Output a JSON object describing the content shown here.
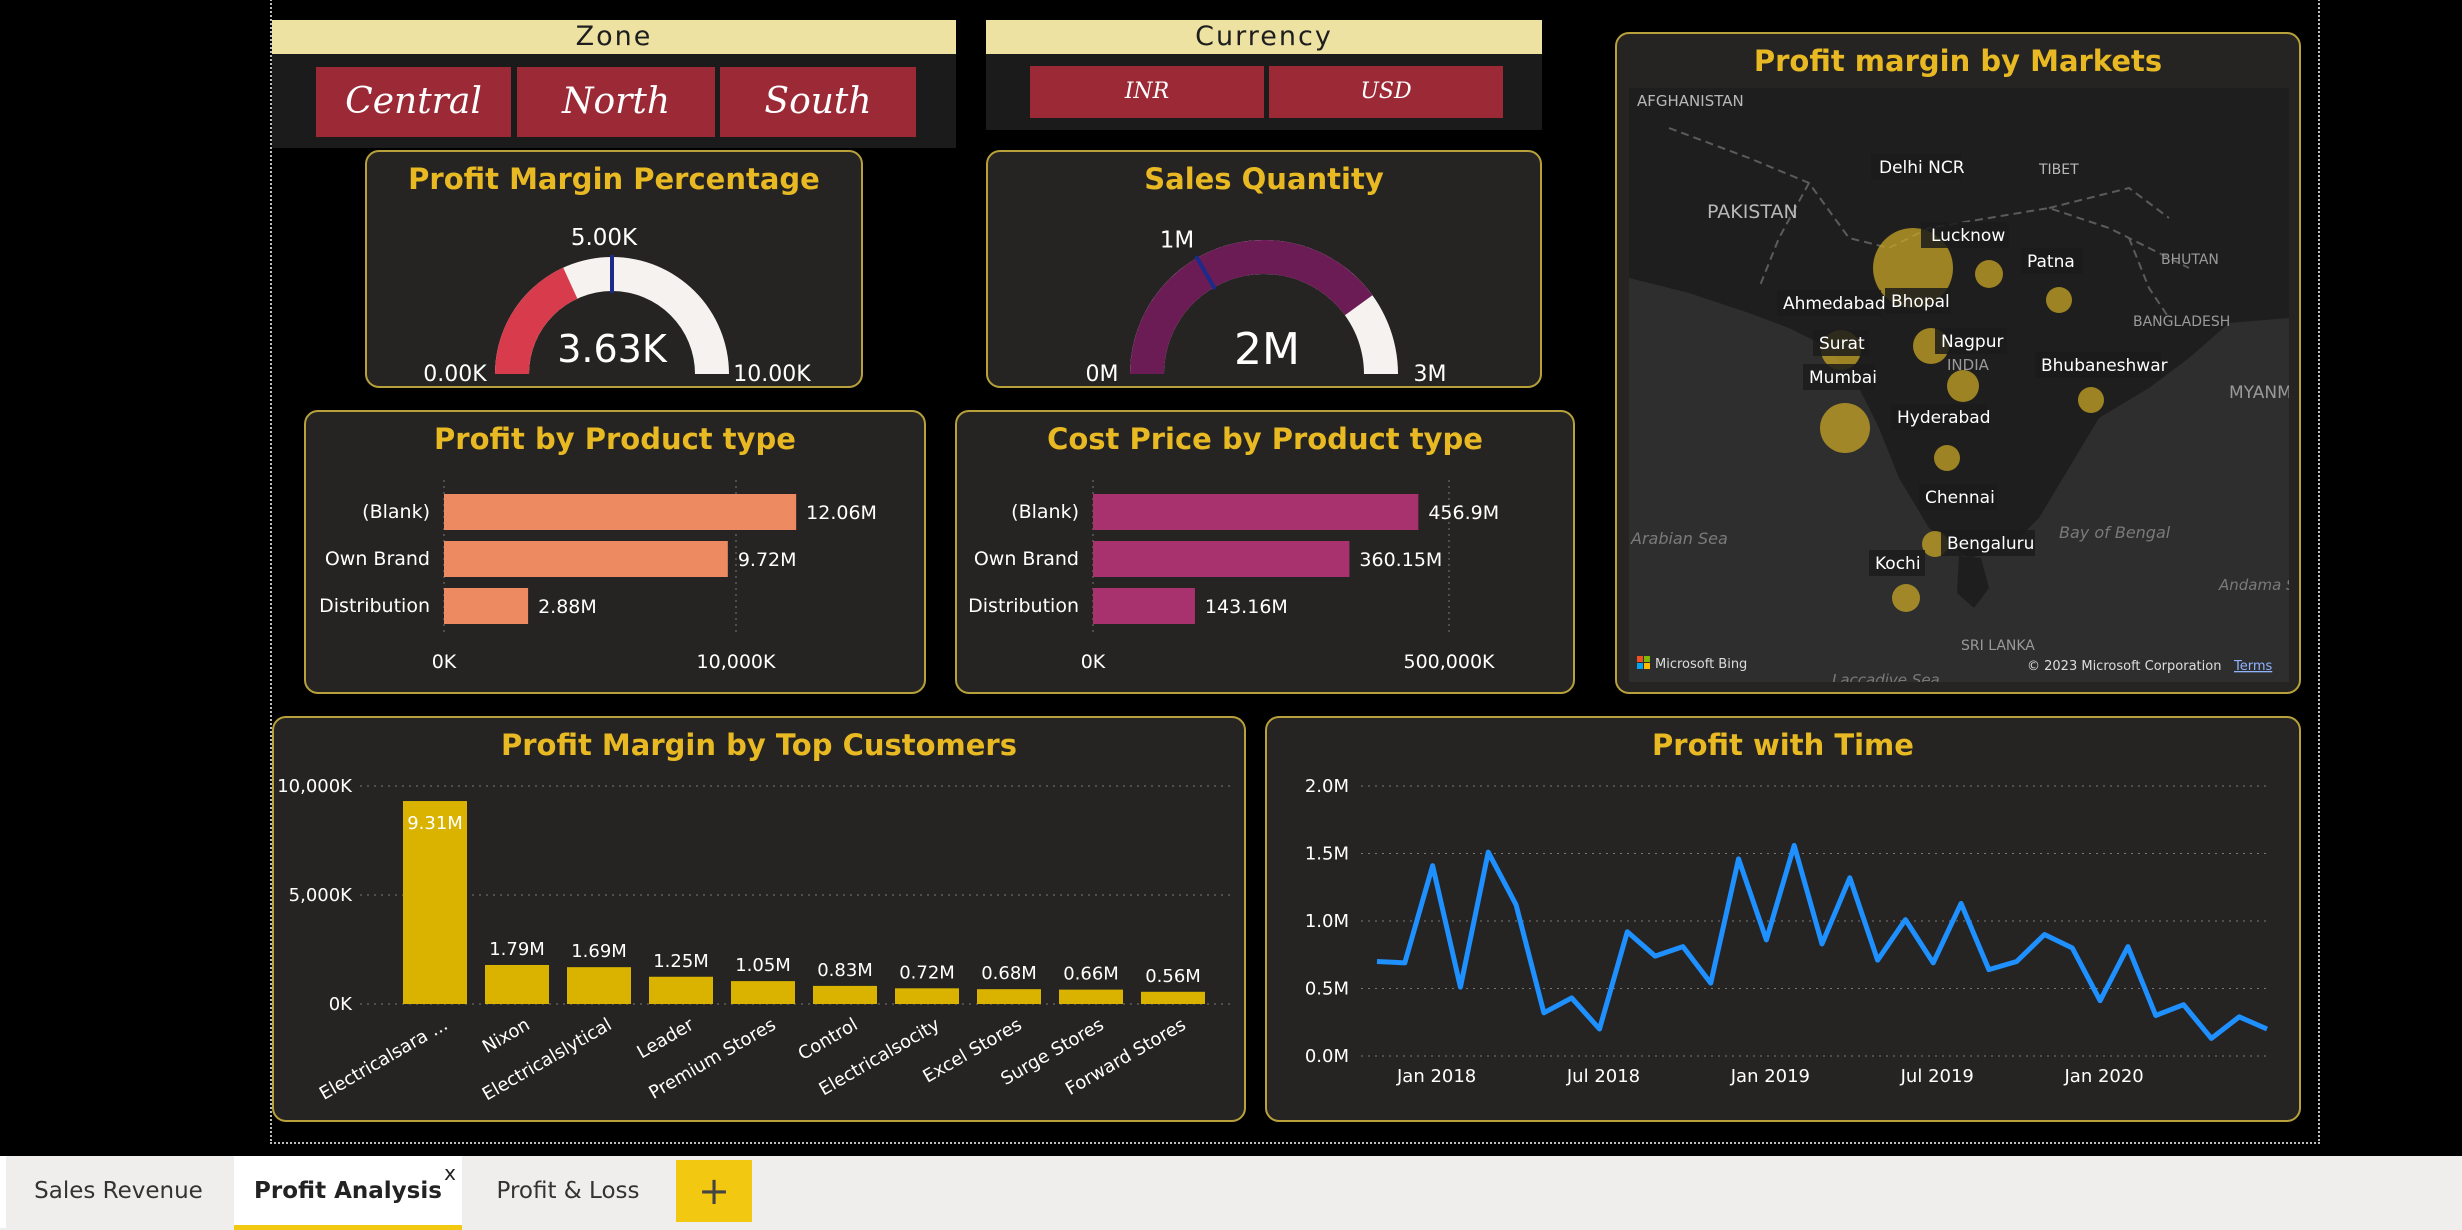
{
  "slicers": {
    "zone": {
      "title": "Zone",
      "options": [
        "Central",
        "North",
        "South"
      ]
    },
    "currency": {
      "title": "Currency",
      "options": [
        "INR",
        "USD"
      ]
    }
  },
  "gauges": {
    "profit_margin": {
      "title": "Profit Margin Percentage",
      "min_label": "0.00K",
      "max_label": "10.00K",
      "target_label": "5.00K",
      "value_label": "3.63K",
      "min": 0,
      "max": 10000,
      "value": 3630,
      "target": 5000,
      "fill_color": "#d83b4b"
    },
    "sales_qty": {
      "title": "Sales Quantity",
      "min_label": "0M",
      "max_label": "3M",
      "target_label": "1M",
      "value_label": "2M",
      "min": 0,
      "max": 3,
      "value": 2.4,
      "target": 1,
      "fill_color": "#6b1c54"
    }
  },
  "map": {
    "title": "Profit margin by Markets",
    "countries": [
      "AFGHANISTAN",
      "PAKISTAN",
      "TIBET",
      "BHUTAN",
      "BANGLADESH",
      "INDIA",
      "MYANM",
      "SRI LANKA",
      "Andama Sea",
      "Laccadive Sea",
      "Arabian Sea",
      "Bay of Bengal"
    ],
    "cities": [
      "Delhi NCR",
      "Lucknow",
      "Patna",
      "Ahmedabad",
      "Bhopal",
      "Surat",
      "Nagpur",
      "Mumbai",
      "Bhubaneshwar",
      "Hyderabad",
      "Chennai",
      "Bengaluru",
      "Kochi"
    ],
    "attribution": "Microsoft Bing",
    "copyright": "© 2023 Microsoft Corporation",
    "terms": "Terms"
  },
  "tabs": {
    "items": [
      "Sales Revenue",
      "Profit Analysis",
      "Profit & Loss"
    ],
    "active": "Profit Analysis",
    "close": "x",
    "add": "+"
  },
  "chart_data": [
    {
      "id": "profit_by_product",
      "type": "bar",
      "orientation": "horizontal",
      "title": "Profit by Product type",
      "categories": [
        "(Blank)",
        "Own Brand",
        "Distribution"
      ],
      "values": [
        12060000,
        9720000,
        2880000
      ],
      "data_labels": [
        "12.06M",
        "9.72M",
        "2.88M"
      ],
      "x_ticks": [
        "0K",
        "10,000K"
      ],
      "xlim": [
        0,
        10000000
      ],
      "color": "#ee8a62"
    },
    {
      "id": "cost_by_product",
      "type": "bar",
      "orientation": "horizontal",
      "title": "Cost Price by Product type",
      "categories": [
        "(Blank)",
        "Own Brand",
        "Distribution"
      ],
      "values": [
        456900000,
        360150000,
        143160000
      ],
      "data_labels": [
        "456.9M",
        "360.15M",
        "143.16M"
      ],
      "x_ticks": [
        "0K",
        "500,000K"
      ],
      "xlim": [
        0,
        500000000
      ],
      "color": "#a8326e"
    },
    {
      "id": "top_customers",
      "type": "bar",
      "title": "Profit Margin by Top Customers",
      "categories": [
        "Electricalsara ...",
        "Nixon",
        "Electricalslytical",
        "Leader",
        "Premium Stores",
        "Control",
        "Electricalsocity",
        "Excel Stores",
        "Surge Stores",
        "Forward Stores"
      ],
      "values": [
        9310000,
        1790000,
        1690000,
        1250000,
        1050000,
        830000,
        720000,
        680000,
        660000,
        560000
      ],
      "data_labels": [
        "9.31M",
        "1.79M",
        "1.69M",
        "1.25M",
        "1.05M",
        "0.83M",
        "0.72M",
        "0.68M",
        "0.66M",
        "0.56M"
      ],
      "y_ticks": [
        "0K",
        "5,000K",
        "10,000K"
      ],
      "ylim": [
        0,
        10000000
      ],
      "color": "#d9b300"
    },
    {
      "id": "profit_time",
      "type": "line",
      "title": "Profit with Time",
      "x_ticks": [
        "Jan 2018",
        "Jul 2018",
        "Jan 2019",
        "Jul 2019",
        "Jan 2020"
      ],
      "x_tick_index": [
        2,
        8,
        14,
        20,
        26
      ],
      "y_ticks": [
        "0.0M",
        "0.5M",
        "1.0M",
        "1.5M",
        "2.0M"
      ],
      "ylim": [
        0,
        2000000
      ],
      "values": [
        700000,
        690000,
        1410000,
        510000,
        1510000,
        1120000,
        320000,
        430000,
        200000,
        920000,
        740000,
        810000,
        540000,
        1460000,
        860000,
        1560000,
        830000,
        1320000,
        710000,
        1010000,
        690000,
        1130000,
        640000,
        700000,
        900000,
        800000,
        410000,
        810000,
        300000,
        380000,
        130000,
        290000,
        200000
      ],
      "color": "#1e90ff"
    }
  ]
}
